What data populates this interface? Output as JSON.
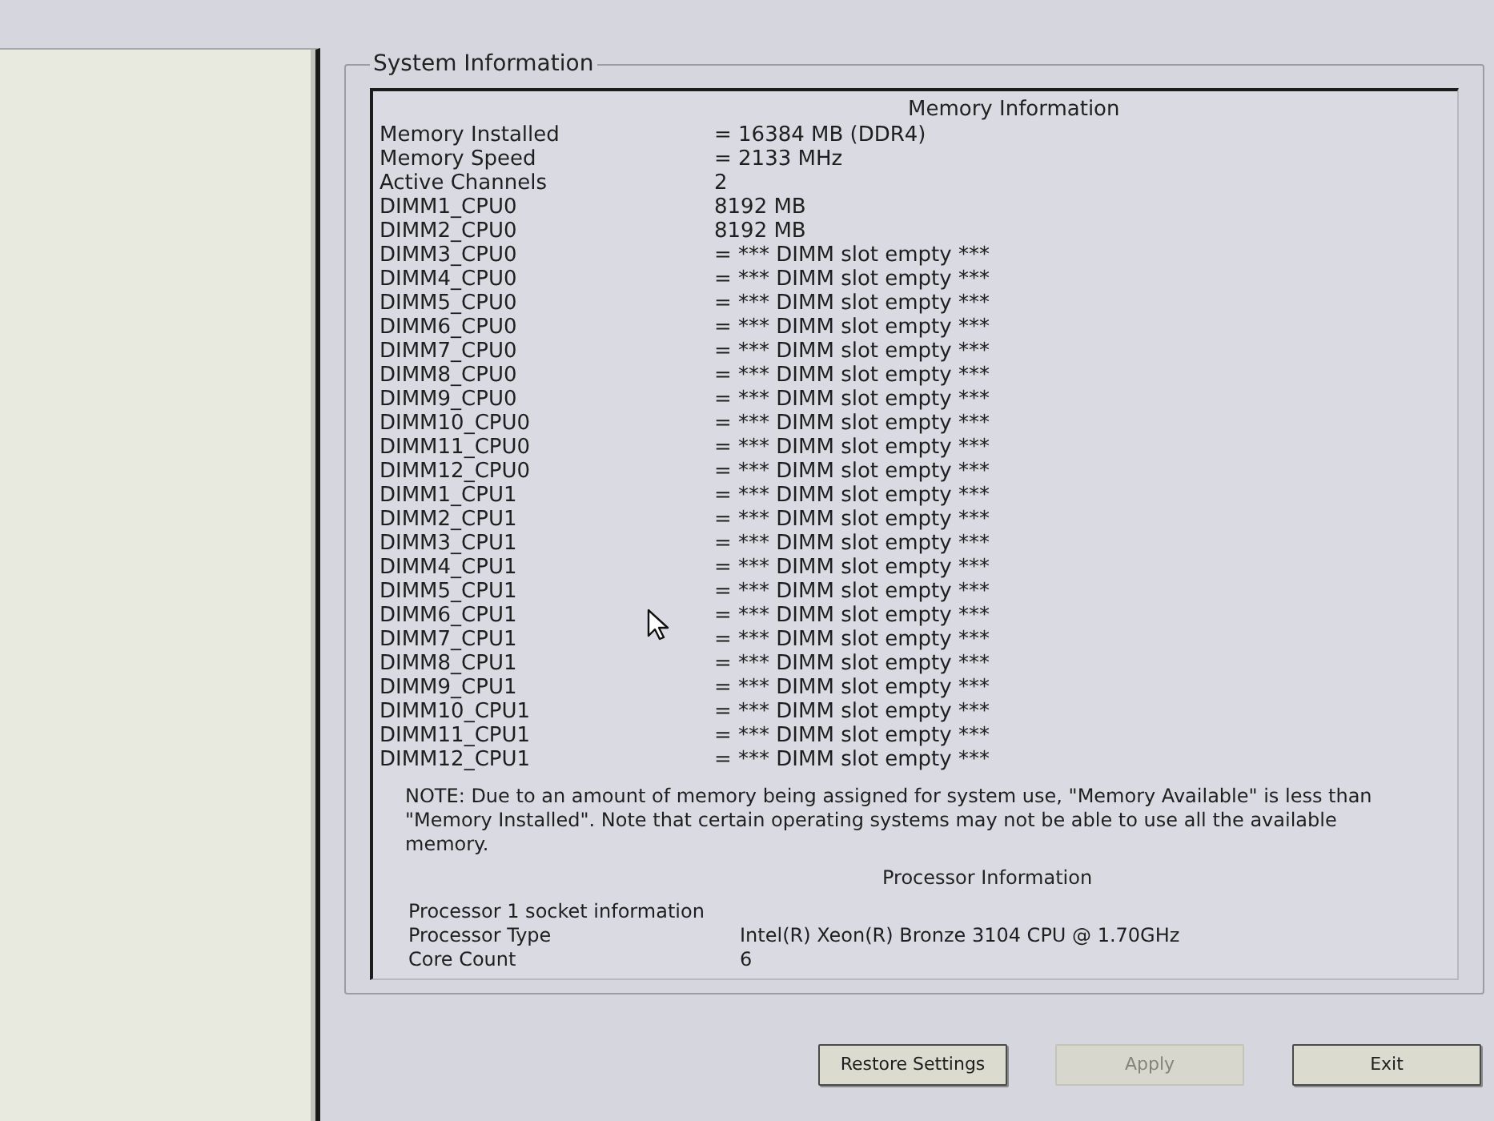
{
  "group": {
    "title": "System Information"
  },
  "memory": {
    "heading": "Memory Information",
    "rows": [
      {
        "label": "Memory Installed",
        "value": "= 16384 MB (DDR4)"
      },
      {
        "label": "Memory Speed",
        "value": "= 2133 MHz"
      },
      {
        "label": "Active Channels",
        "value": "2"
      },
      {
        "label": "DIMM1_CPU0",
        "value": "8192 MB"
      },
      {
        "label": "DIMM2_CPU0",
        "value": "8192 MB"
      },
      {
        "label": "DIMM3_CPU0",
        "value": "= *** DIMM slot empty ***"
      },
      {
        "label": "DIMM4_CPU0",
        "value": "= *** DIMM slot empty ***"
      },
      {
        "label": "DIMM5_CPU0",
        "value": "= *** DIMM slot empty ***"
      },
      {
        "label": "DIMM6_CPU0",
        "value": "= *** DIMM slot empty ***"
      },
      {
        "label": "DIMM7_CPU0",
        "value": "= *** DIMM slot empty ***"
      },
      {
        "label": "DIMM8_CPU0",
        "value": "= *** DIMM slot empty ***"
      },
      {
        "label": "DIMM9_CPU0",
        "value": "= *** DIMM slot empty ***"
      },
      {
        "label": "DIMM10_CPU0",
        "value": "= *** DIMM slot empty ***"
      },
      {
        "label": "DIMM11_CPU0",
        "value": "= *** DIMM slot empty ***"
      },
      {
        "label": "DIMM12_CPU0",
        "value": "= *** DIMM slot empty ***"
      },
      {
        "label": "DIMM1_CPU1",
        "value": "= *** DIMM slot empty ***"
      },
      {
        "label": "DIMM2_CPU1",
        "value": "= *** DIMM slot empty ***"
      },
      {
        "label": "DIMM3_CPU1",
        "value": "= *** DIMM slot empty ***"
      },
      {
        "label": "DIMM4_CPU1",
        "value": "= *** DIMM slot empty ***"
      },
      {
        "label": "DIMM5_CPU1",
        "value": "= *** DIMM slot empty ***"
      },
      {
        "label": "DIMM6_CPU1",
        "value": "= *** DIMM slot empty ***"
      },
      {
        "label": "DIMM7_CPU1",
        "value": "= *** DIMM slot empty ***"
      },
      {
        "label": "DIMM8_CPU1",
        "value": "= *** DIMM slot empty ***"
      },
      {
        "label": "DIMM9_CPU1",
        "value": "= *** DIMM slot empty ***"
      },
      {
        "label": "DIMM10_CPU1",
        "value": "= *** DIMM slot empty ***"
      },
      {
        "label": "DIMM11_CPU1",
        "value": "= *** DIMM slot empty ***"
      },
      {
        "label": "DIMM12_CPU1",
        "value": "= *** DIMM slot empty ***"
      }
    ],
    "note": "NOTE: Due to an amount of memory being assigned for system use, \"Memory Available\" is less than \"Memory Installed\". Note that certain operating systems may not be able to use all the available memory."
  },
  "processor": {
    "heading": "Processor Information",
    "socket_label": "Processor 1 socket information",
    "rows": [
      {
        "label": "Processor Type",
        "value": "Intel(R) Xeon(R) Bronze 3104 CPU @ 1.70GHz"
      },
      {
        "label": "Core Count",
        "value": "6"
      }
    ]
  },
  "buttons": [
    {
      "label": "Restore Settings",
      "disabled": false
    },
    {
      "label": "Apply",
      "disabled": true
    },
    {
      "label": "Exit",
      "disabled": false
    }
  ]
}
